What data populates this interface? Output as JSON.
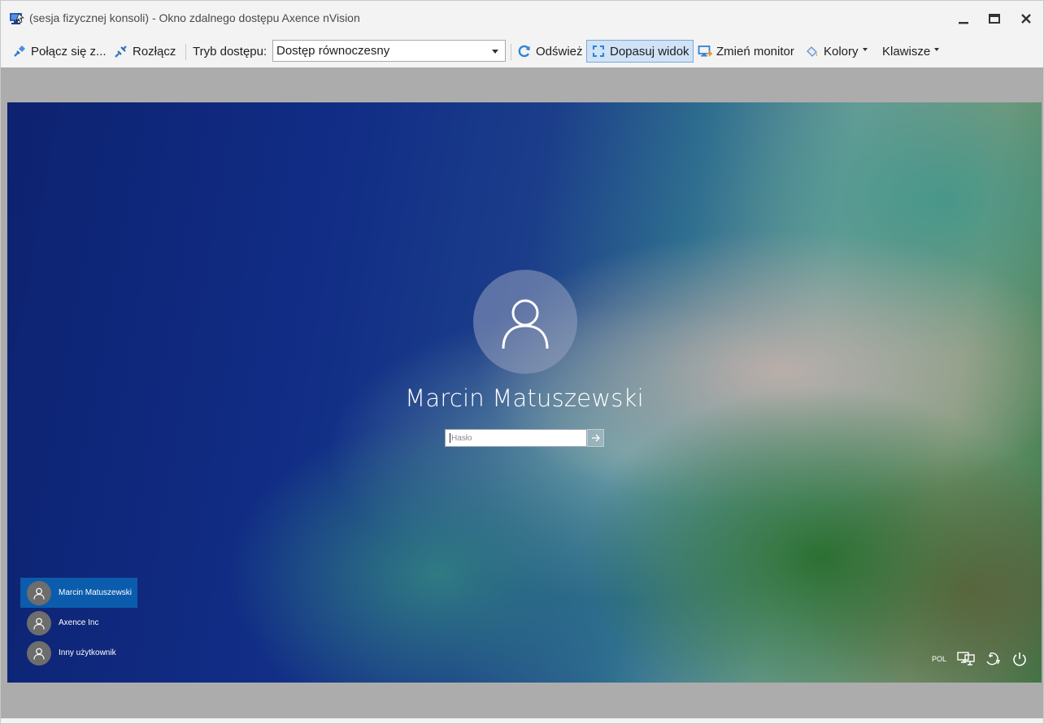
{
  "window": {
    "title": "(sesja fizycznej konsoli) - Okno zdalnego dostępu Axence nVision",
    "icon": "remote-desktop-icon",
    "controls": [
      "minimize-icon",
      "maximize-icon",
      "close-icon"
    ]
  },
  "toolbar": {
    "connect_label": "Połącz się z...",
    "disconnect_label": "Rozłącz",
    "access_mode_label": "Tryb dostępu:",
    "access_mode_value": "Dostęp równoczesny",
    "refresh_label": "Odśwież",
    "fit_view_label": "Dopasuj widok",
    "change_monitor_label": "Zmień monitor",
    "colors_label": "Kolory",
    "keys_label": "Klawisze"
  },
  "login_screen": {
    "user_name": "Marcin Matuszewski",
    "password_placeholder": "Hasło",
    "users": [
      {
        "name": "Marcin Matuszewski",
        "selected": true
      },
      {
        "name": "Axence Inc",
        "selected": false
      },
      {
        "name": "Inny użytkownik",
        "selected": false
      }
    ],
    "tray": {
      "language": "POL",
      "icons": [
        "network-icon",
        "accessibility-icon",
        "power-icon"
      ]
    }
  },
  "colors": {
    "accent": "#0b5cad",
    "active_button_bg": "#cfe2f6",
    "remote_background": "#acacac"
  }
}
